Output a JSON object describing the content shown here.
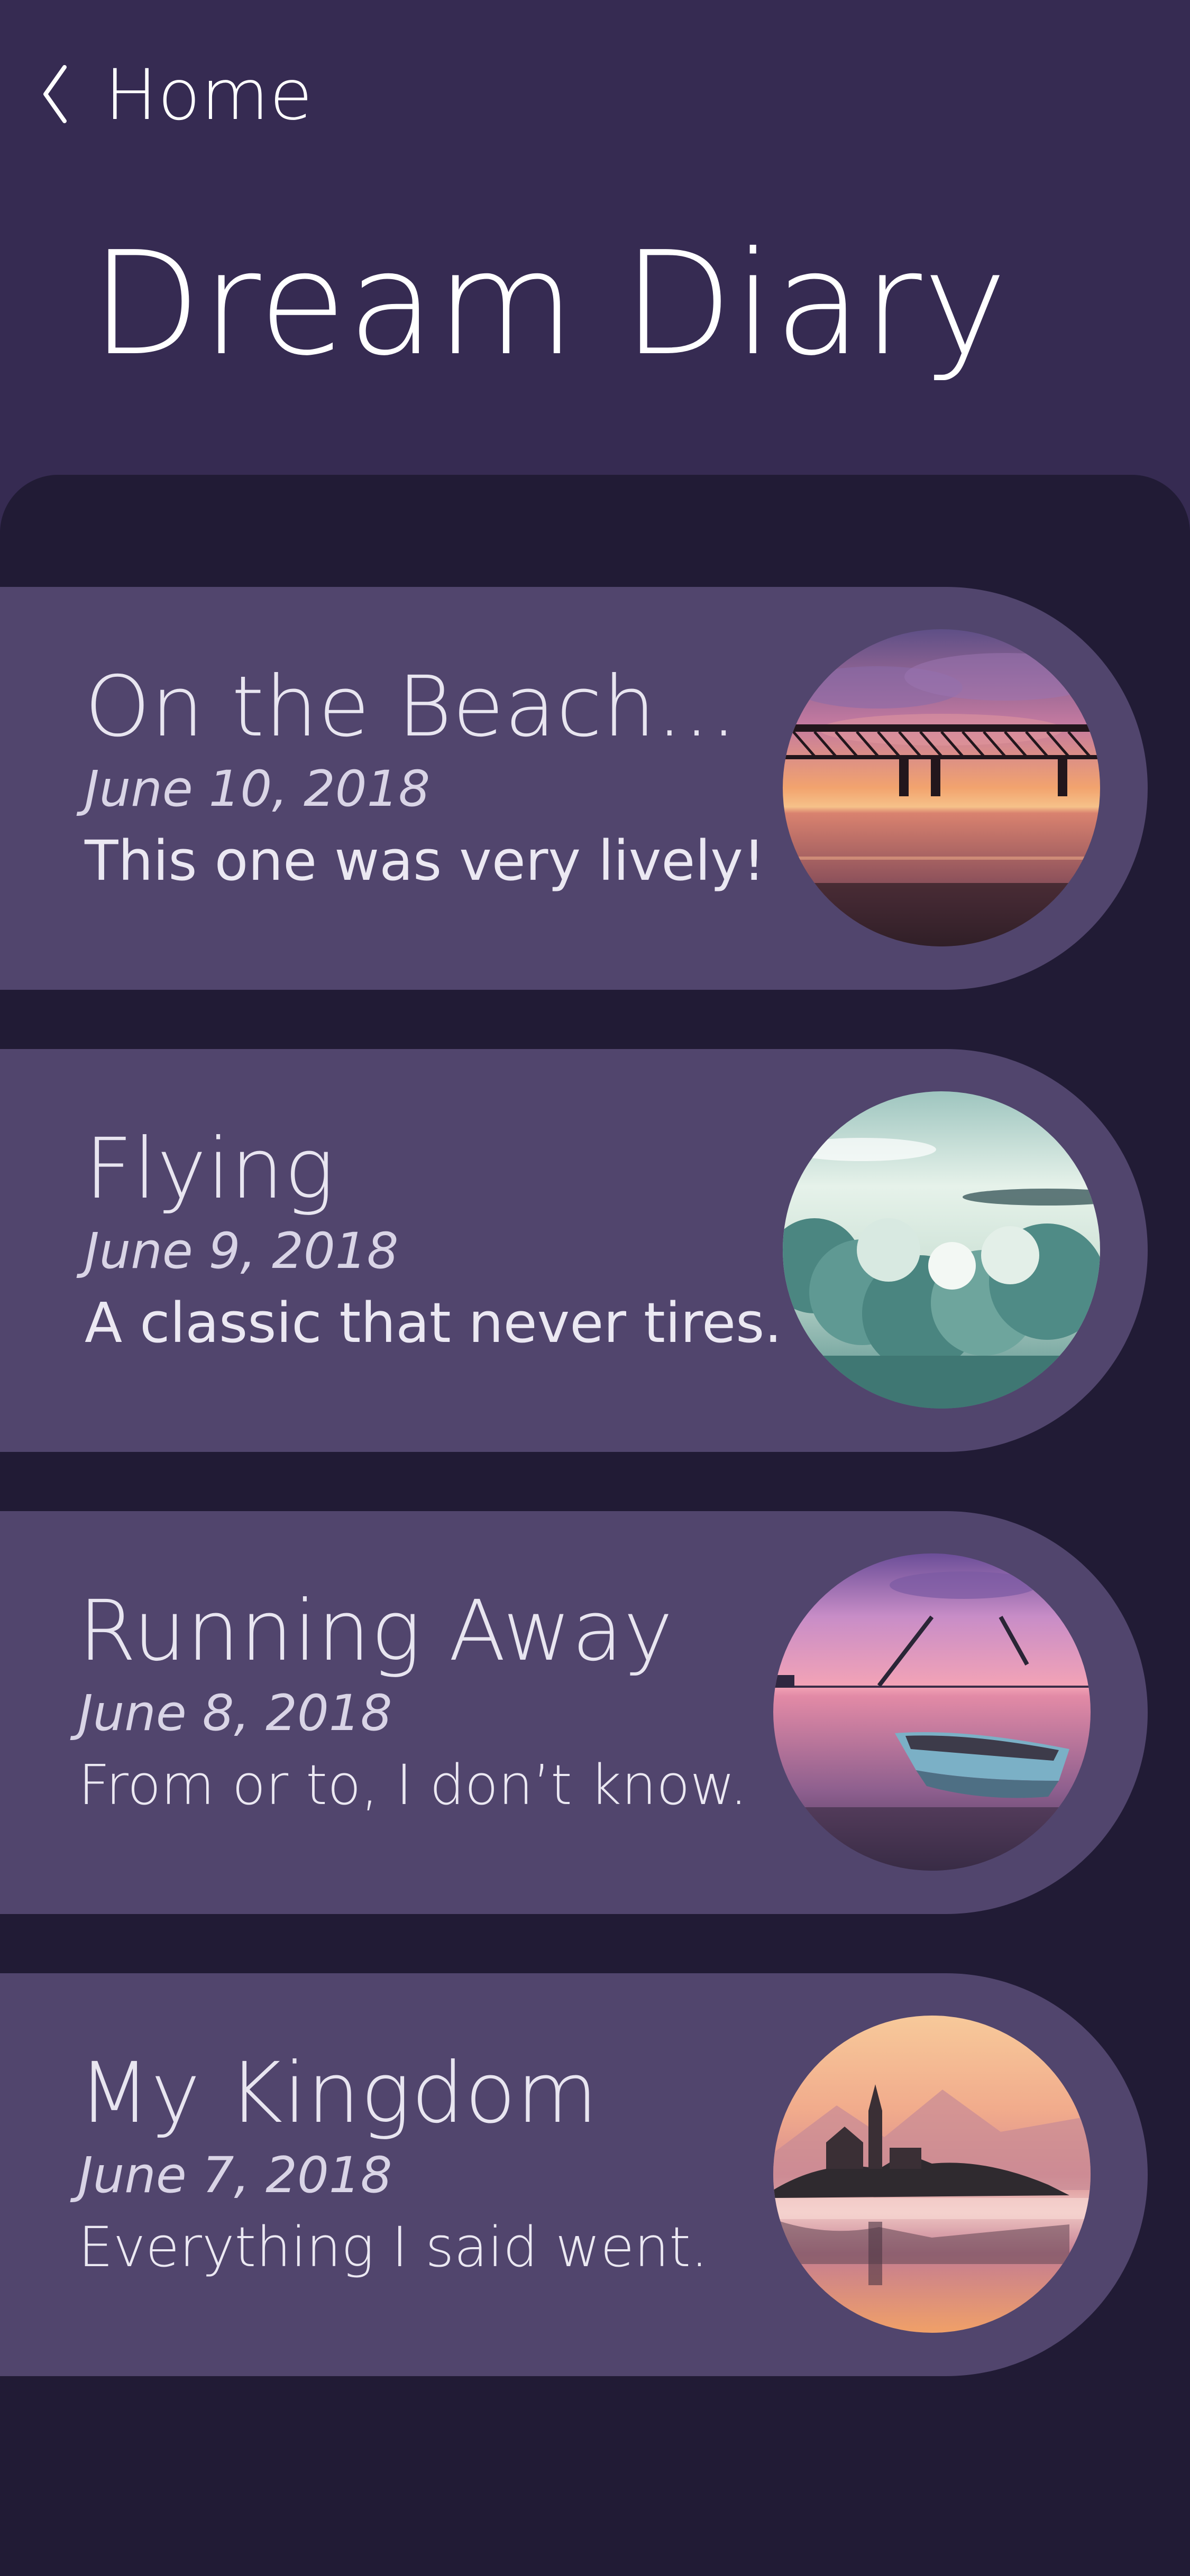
{
  "nav": {
    "back_label": "Home",
    "back_icon": "chevron-left-icon"
  },
  "page": {
    "title": "Dream Diary"
  },
  "colors": {
    "header_bg": "#362b52",
    "sheet_bg": "#211b35",
    "card_bg": "#51456d",
    "text": "#ffffff"
  },
  "entries": [
    {
      "title": "On the Beach...",
      "date": "June 10, 2018",
      "description": "This one was very lively!",
      "image": "sunset-pier-photo"
    },
    {
      "title": "Flying",
      "date": "June 9, 2018",
      "description": "A classic that never tires.",
      "image": "clouds-photo"
    },
    {
      "title": "Running Away",
      "date": "June 8, 2018",
      "description": "From or to, I don’t know.",
      "image": "boat-lake-photo"
    },
    {
      "title": "My Kingdom",
      "date": "June 7, 2018",
      "description": "Everything I said went.",
      "image": "island-castle-photo"
    }
  ]
}
